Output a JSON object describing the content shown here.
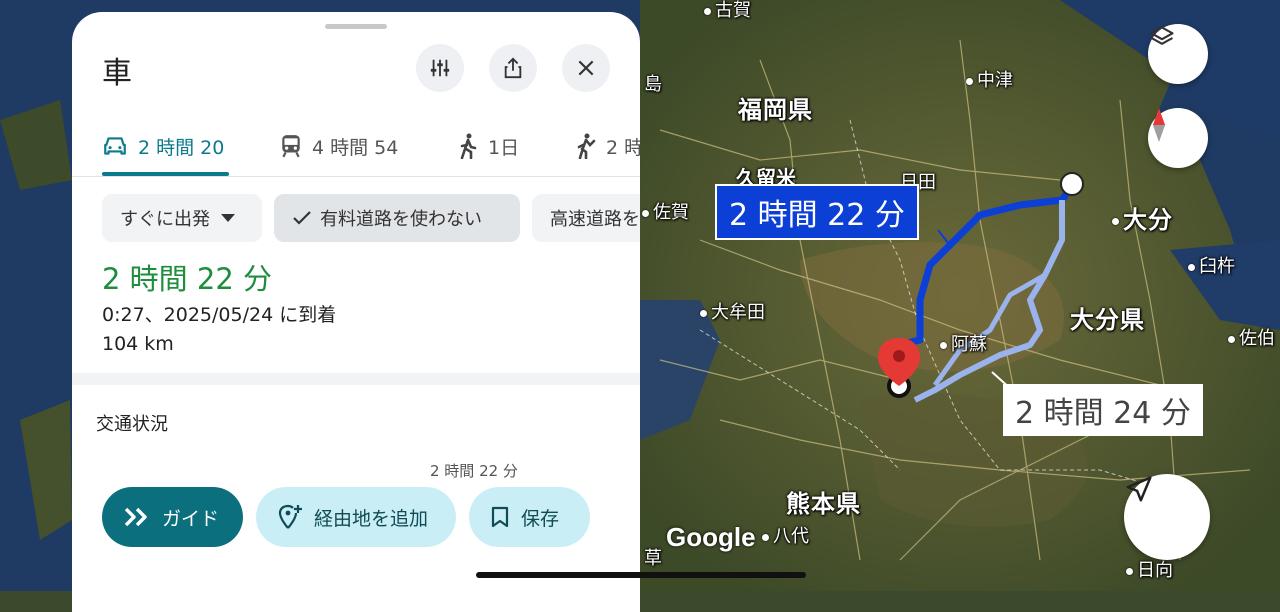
{
  "sheet": {
    "title": "車",
    "tabs": [
      {
        "label": "2 時間 20",
        "icon": "car-icon"
      },
      {
        "label": "4 時間 54",
        "icon": "transit-icon"
      },
      {
        "label": "1日",
        "icon": "walk-icon"
      },
      {
        "label": "2 時",
        "icon": "ride-icon"
      }
    ],
    "chips": [
      "すぐに出発",
      "有料道路を使わない",
      "高速道路を"
    ],
    "duration": "2 時間 22 分",
    "arrival": "0:27、2025/05/24 に到着",
    "distance": "104 km",
    "traffic_title": "交通状況",
    "traffic_label": "2 時間 22 分",
    "actions": {
      "guide": "ガイド",
      "add_stop": "経由地を追加",
      "save": "保存"
    }
  },
  "map": {
    "route_main_label": "2 時間 22 分",
    "route_alt_label": "2 時間 24 分",
    "places": {
      "furuga": "古賀",
      "shima": "島",
      "nakatsu": "中津",
      "fukuoka_pref": "福岡県",
      "kurume": "久留米",
      "hita": "日田",
      "saga": "佐賀",
      "oita": "大分",
      "usuki": "臼杵",
      "omuta": "大牟田",
      "oita_pref": "大分県",
      "aso": "阿蘇",
      "saiki": "佐伯",
      "kumamoto_pref": "熊本県",
      "yatsushiro": "八代",
      "amakusa": "草",
      "hyuga": "日向"
    },
    "attribution": "Google"
  }
}
